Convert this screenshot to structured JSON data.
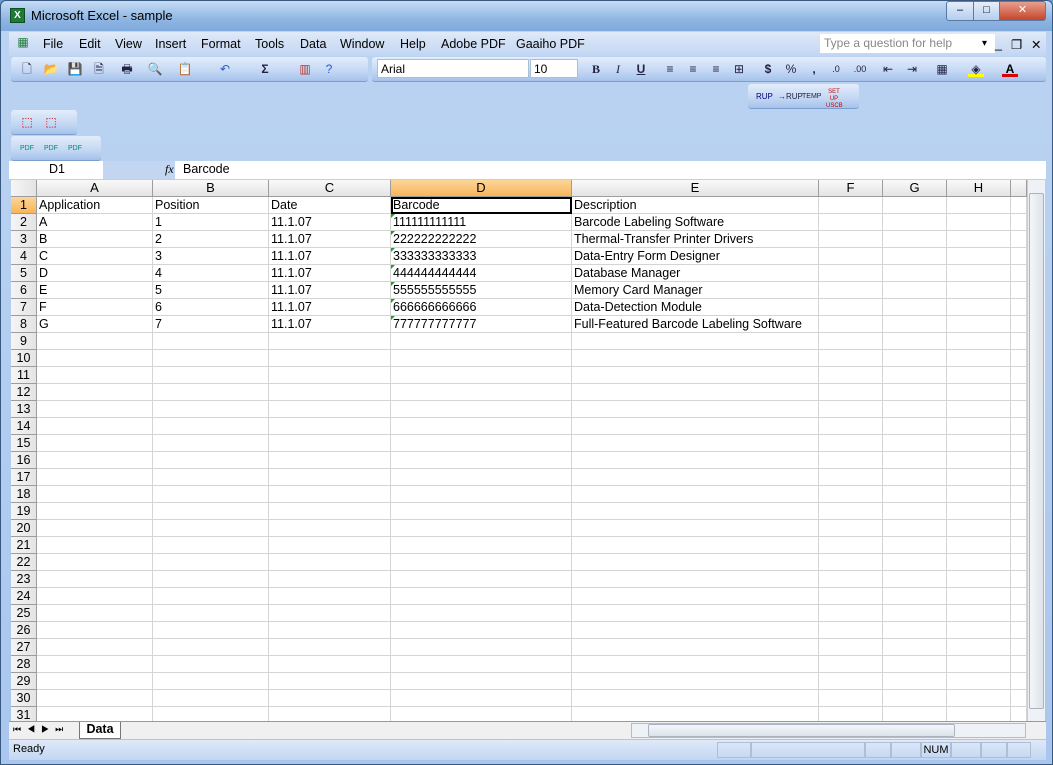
{
  "window": {
    "title": "Microsoft Excel - sample",
    "minimize": "–",
    "maximize": "□",
    "close": "✕"
  },
  "menu": [
    "File",
    "Edit",
    "View",
    "Insert",
    "Format",
    "Tools",
    "Data",
    "Window",
    "Help",
    "Adobe PDF",
    "Gaaiho PDF"
  ],
  "help_placeholder": "Type a question for help",
  "format": {
    "font": "Arial",
    "size": "10",
    "bold": "B",
    "italic": "I",
    "underline": "U",
    "currency": "$",
    "percent": "%",
    "comma": ","
  },
  "custom_toolbar": [
    "RUP",
    "→RUP",
    "TEMP",
    "SET UP USCB"
  ],
  "name_box": "D1",
  "fx": "fx",
  "formula": "Barcode",
  "columns": [
    "A",
    "B",
    "C",
    "D",
    "E",
    "F",
    "G",
    "H"
  ],
  "active_column": "D",
  "active_row": 1,
  "rows": [
    [
      "Application",
      "Position",
      "Date",
      "Barcode",
      "Description"
    ],
    [
      "A",
      "1",
      "11.1.07",
      "111111111111",
      "Barcode Labeling Software"
    ],
    [
      "B",
      "2",
      "11.1.07",
      "222222222222",
      "Thermal-Transfer Printer Drivers"
    ],
    [
      "C",
      "3",
      "11.1.07",
      "333333333333",
      "Data-Entry Form Designer"
    ],
    [
      "D",
      "4",
      "11.1.07",
      "444444444444",
      "Database Manager"
    ],
    [
      "E",
      "5",
      "11.1.07",
      "555555555555",
      "Memory Card Manager"
    ],
    [
      "F",
      "6",
      "11.1.07",
      "666666666666",
      "Data-Detection Module"
    ],
    [
      "G",
      "7",
      "11.1.07",
      "777777777777",
      "Full-Featured Barcode Labeling Software"
    ]
  ],
  "visible_row_count": 31,
  "sheet_tab": "Data",
  "status": {
    "ready": "Ready",
    "num": "NUM"
  }
}
